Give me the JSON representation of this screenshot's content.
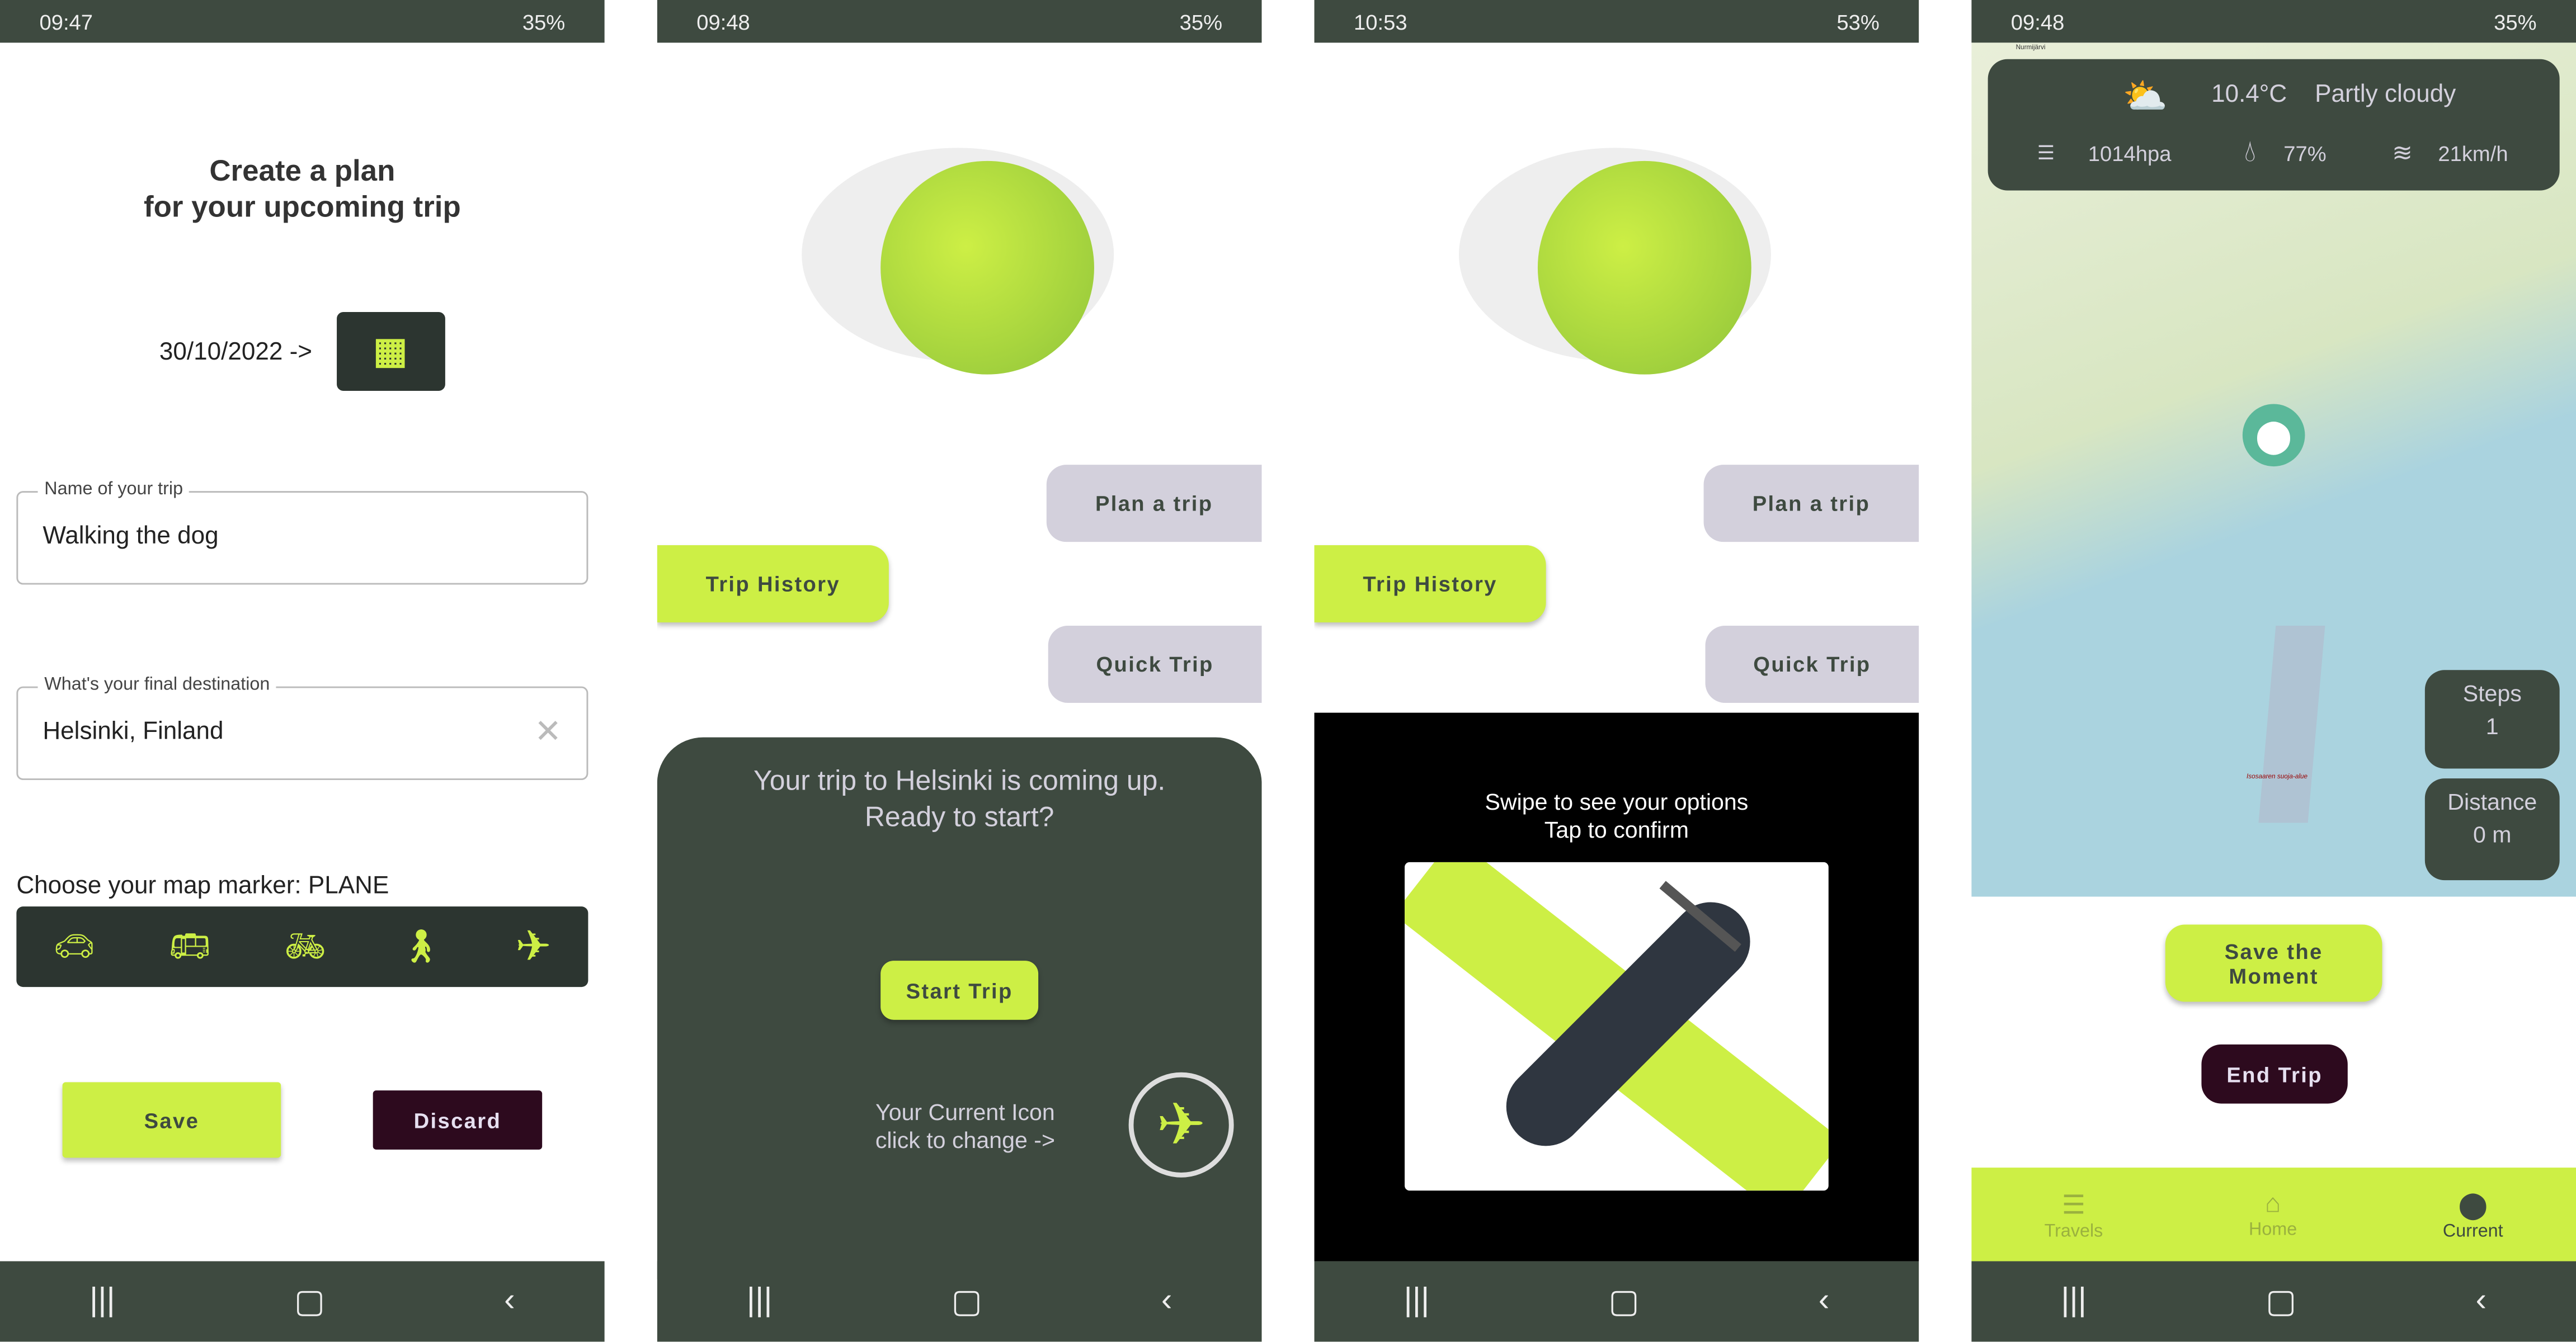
{
  "colors": {
    "dark": "#3e4a40",
    "lime": "#cdef45",
    "lavender": "#d3d0dc",
    "maroon": "#2d0a1e"
  },
  "screens": [
    {
      "status": {
        "time": "09:47",
        "battery": "35%"
      },
      "title_line1": "Create a plan",
      "title_line2": "for your upcoming trip",
      "date": "30/10/2022 ->",
      "trip_name": {
        "label": "Name of your trip",
        "value": "Walking the dog"
      },
      "destination": {
        "label": "What's your final destination",
        "value": "Helsinki, Finland"
      },
      "marker_label": "Choose your map marker: PLANE",
      "markers": [
        "car-icon",
        "bus-icon",
        "bike-icon",
        "walk-icon",
        "plane-icon"
      ],
      "save": "Save",
      "discard": "Discard"
    },
    {
      "status": {
        "time": "09:48",
        "battery": "35%"
      },
      "plan": "Plan a trip",
      "history": "Trip History",
      "quick": "Quick Trip",
      "sheet_line1": "Your trip to Helsinki is coming up.",
      "sheet_line2": "Ready to start?",
      "start": "Start Trip",
      "icon_line1": "Your Current Icon",
      "icon_line2": "click to change ->"
    },
    {
      "status": {
        "time": "10:53",
        "battery": "53%"
      },
      "plan": "Plan a trip",
      "history": "Trip History",
      "quick": "Quick Trip",
      "swipe_line1": "Swipe to see your options",
      "swipe_line2": "Tap to confirm"
    },
    {
      "status": {
        "time": "09:48",
        "battery": "35%"
      },
      "weather": {
        "temp": "10.4°C",
        "desc": "Partly cloudy",
        "pressure": "1014hpa",
        "humidity": "77%",
        "wind": "21km/h"
      },
      "map_labels": [
        "Nurmijärvi",
        "Isosaaren suoja-alue"
      ],
      "steps_label": "Steps",
      "steps": "1",
      "distance_label": "Distance",
      "distance": "0 m",
      "save_moment": "Save the Moment",
      "end": "End Trip",
      "tabs": [
        "Travels",
        "Home",
        "Current"
      ]
    }
  ]
}
